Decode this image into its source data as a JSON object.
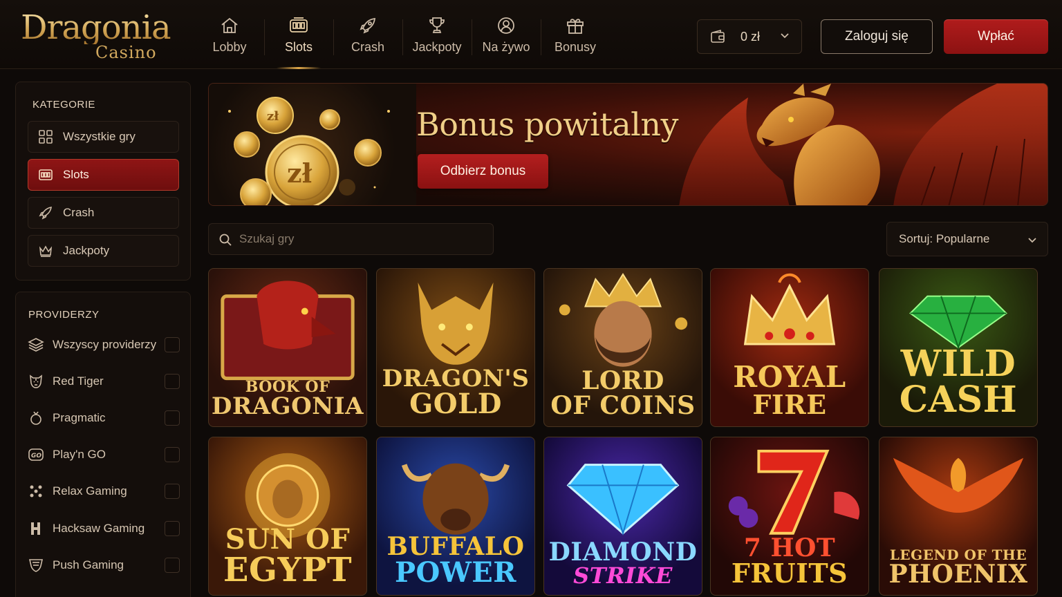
{
  "brand": {
    "name": "Dragonia",
    "sub": "Casino"
  },
  "nav": [
    {
      "label": "Lobby",
      "icon": "home-icon"
    },
    {
      "label": "Slots",
      "icon": "slot-machine-icon",
      "active": true
    },
    {
      "label": "Crash",
      "icon": "rocket-icon"
    },
    {
      "label": "Jackpoty",
      "icon": "trophy-icon"
    },
    {
      "label": "Na żywo",
      "icon": "live-user-icon"
    },
    {
      "label": "Bonusy",
      "icon": "gift-icon"
    }
  ],
  "wallet": {
    "amount": "0 zł",
    "icon": "wallet-icon"
  },
  "auth": {
    "login": "Zaloguj się",
    "deposit": "Wpłać"
  },
  "categories": {
    "title": "KATEGORIE",
    "items": [
      {
        "label": "Wszystkie gry",
        "icon": "grid-icon"
      },
      {
        "label": "Slots",
        "icon": "slot-machine-icon",
        "active": true
      },
      {
        "label": "Crash",
        "icon": "rocket-icon"
      },
      {
        "label": "Jackpoty",
        "icon": "crown-icon"
      }
    ]
  },
  "providers": {
    "title": "PROVIDERZY",
    "items": [
      {
        "label": "Wszyscy providerzy",
        "icon": "layers-icon",
        "checked": false
      },
      {
        "label": "Red Tiger",
        "icon": "tiger-icon",
        "checked": false
      },
      {
        "label": "Pragmatic",
        "icon": "pragmatic-icon",
        "checked": false
      },
      {
        "label": "Play'n GO",
        "icon": "playngo-icon",
        "checked": false
      },
      {
        "label": "Relax Gaming",
        "icon": "relax-icon",
        "checked": false
      },
      {
        "label": "Hacksaw Gaming",
        "icon": "hacksaw-icon",
        "checked": false
      },
      {
        "label": "Push Gaming",
        "icon": "push-icon",
        "checked": false
      }
    ]
  },
  "banner": {
    "title": "Bonus powitalny",
    "cta": "Odbierz bonus"
  },
  "search": {
    "placeholder": "Szukaj gry"
  },
  "sort": {
    "label": "Sortuj: Popularne"
  },
  "games": [
    {
      "line1": "BOOK OF",
      "line2": "DRAGONIA",
      "theme": "dragon-book"
    },
    {
      "line1": "DRAGON'S",
      "line2": "GOLD",
      "theme": "gold-dragon"
    },
    {
      "line1": "LORD",
      "line2": "OF COINS",
      "theme": "king"
    },
    {
      "line1": "ROYAL",
      "line2": "FIRE",
      "theme": "crown"
    },
    {
      "line1": "WILD",
      "line2": "CASH",
      "theme": "emerald"
    },
    {
      "line1": "SUN OF",
      "line2": "EGYPT",
      "theme": "sun"
    },
    {
      "line1": "BUFFALO",
      "line2": "POWER",
      "theme": "buffalo"
    },
    {
      "line1": "DIAMOND",
      "line2": "STRIKE",
      "theme": "diamond"
    },
    {
      "line1": "7 HOT",
      "line2": "FRUITS",
      "theme": "seven"
    },
    {
      "line1": "LEGEND OF THE",
      "line2": "PHOENIX",
      "theme": "phoenix"
    }
  ],
  "colors": {
    "accent": "#9a1515",
    "gold": "#d4a857",
    "background": "#0e0a08"
  }
}
